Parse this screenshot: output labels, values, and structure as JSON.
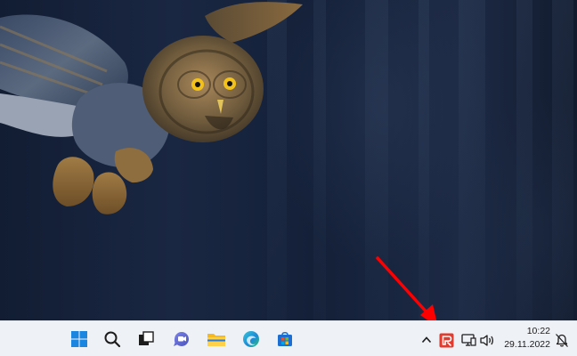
{
  "desktop": {
    "wallpaper": "owl-in-flight"
  },
  "taskbar": {
    "pinned": [
      {
        "name": "start-button",
        "icon": "windows-logo-icon"
      },
      {
        "name": "search-button",
        "icon": "search-icon"
      },
      {
        "name": "task-view-button",
        "icon": "task-view-icon"
      },
      {
        "name": "chat-button",
        "icon": "teams-chat-icon"
      },
      {
        "name": "file-explorer-button",
        "icon": "folder-icon"
      },
      {
        "name": "edge-button",
        "icon": "edge-icon"
      },
      {
        "name": "store-button",
        "icon": "store-icon"
      }
    ],
    "tray": {
      "overflow_icon": "chevron-up-icon",
      "highlighted_app_icon": "red-app-icon",
      "network_icon": "network-icon",
      "volume_icon": "volume-icon",
      "notification_icon": "notification-bell-icon",
      "time": "10:22",
      "date": "29.11.2022"
    },
    "accent_color": "#0078d4"
  },
  "annotation": {
    "arrow_color": "#ff0000",
    "points_to": "red-app-icon"
  }
}
